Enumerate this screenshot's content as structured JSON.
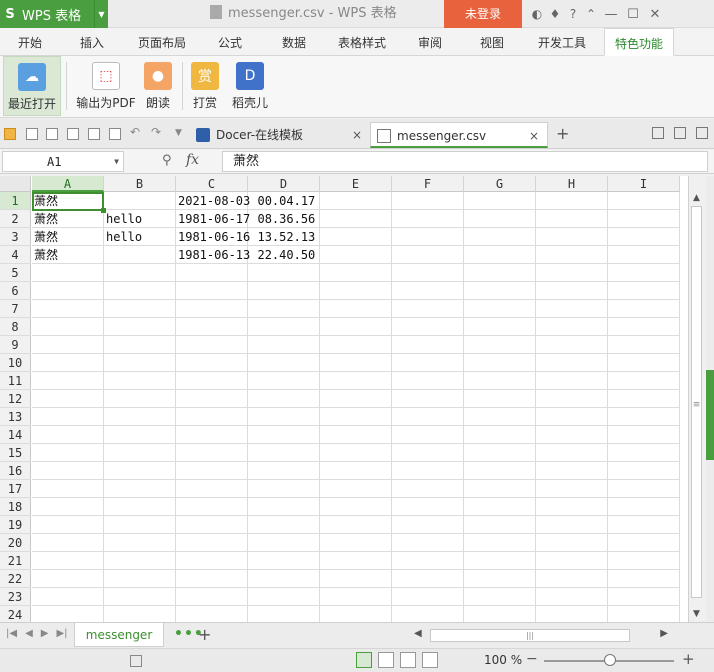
{
  "titlebar": {
    "app_name": "WPS 表格",
    "app_logo": "S",
    "doc_title": "messenger.csv - WPS 表格",
    "login": "未登录",
    "icons": [
      "skin-icon",
      "shirt-icon",
      "help-icon",
      "minimize-ribbon-icon",
      "minimize-icon",
      "maximize-icon",
      "close-icon"
    ],
    "help_label": "?"
  },
  "tabs": [
    "开始",
    "插入",
    "页面布局",
    "公式",
    "数据",
    "表格样式",
    "审阅",
    "视图",
    "开发工具",
    "特色功能"
  ],
  "ribbon": {
    "buttons": [
      "最近打开",
      "输出为PDF",
      "朗读",
      "打赏",
      "稻壳儿"
    ],
    "reward_glyph": "赏"
  },
  "doc_tabs": [
    {
      "label": "Docer-在线模板",
      "close": "×"
    },
    {
      "label": "messenger.csv",
      "close": "×"
    }
  ],
  "formula": {
    "namebox": "A1",
    "fx": "fx",
    "value": "萧然"
  },
  "columns": [
    "A",
    "B",
    "C",
    "D",
    "E",
    "F",
    "G",
    "H",
    "I"
  ],
  "rows": [
    "1",
    "2",
    "3",
    "4",
    "5",
    "6",
    "7",
    "8",
    "9",
    "10",
    "11",
    "12",
    "13",
    "14",
    "15",
    "16",
    "17",
    "18",
    "19",
    "20",
    "21",
    "22",
    "23",
    "24"
  ],
  "cells": [
    [
      "萧然",
      "",
      "2021-08-03 00.04.17"
    ],
    [
      "萧然",
      "hello",
      "1981-06-17 08.36.56"
    ],
    [
      "萧然",
      "hello",
      "1981-06-16 13.52.13"
    ],
    [
      "萧然",
      "",
      "1981-06-13 22.40.50"
    ]
  ],
  "sheet": {
    "name": "messenger",
    "more": "•••",
    "add": "+"
  },
  "status": {
    "zoom": "100 %"
  }
}
